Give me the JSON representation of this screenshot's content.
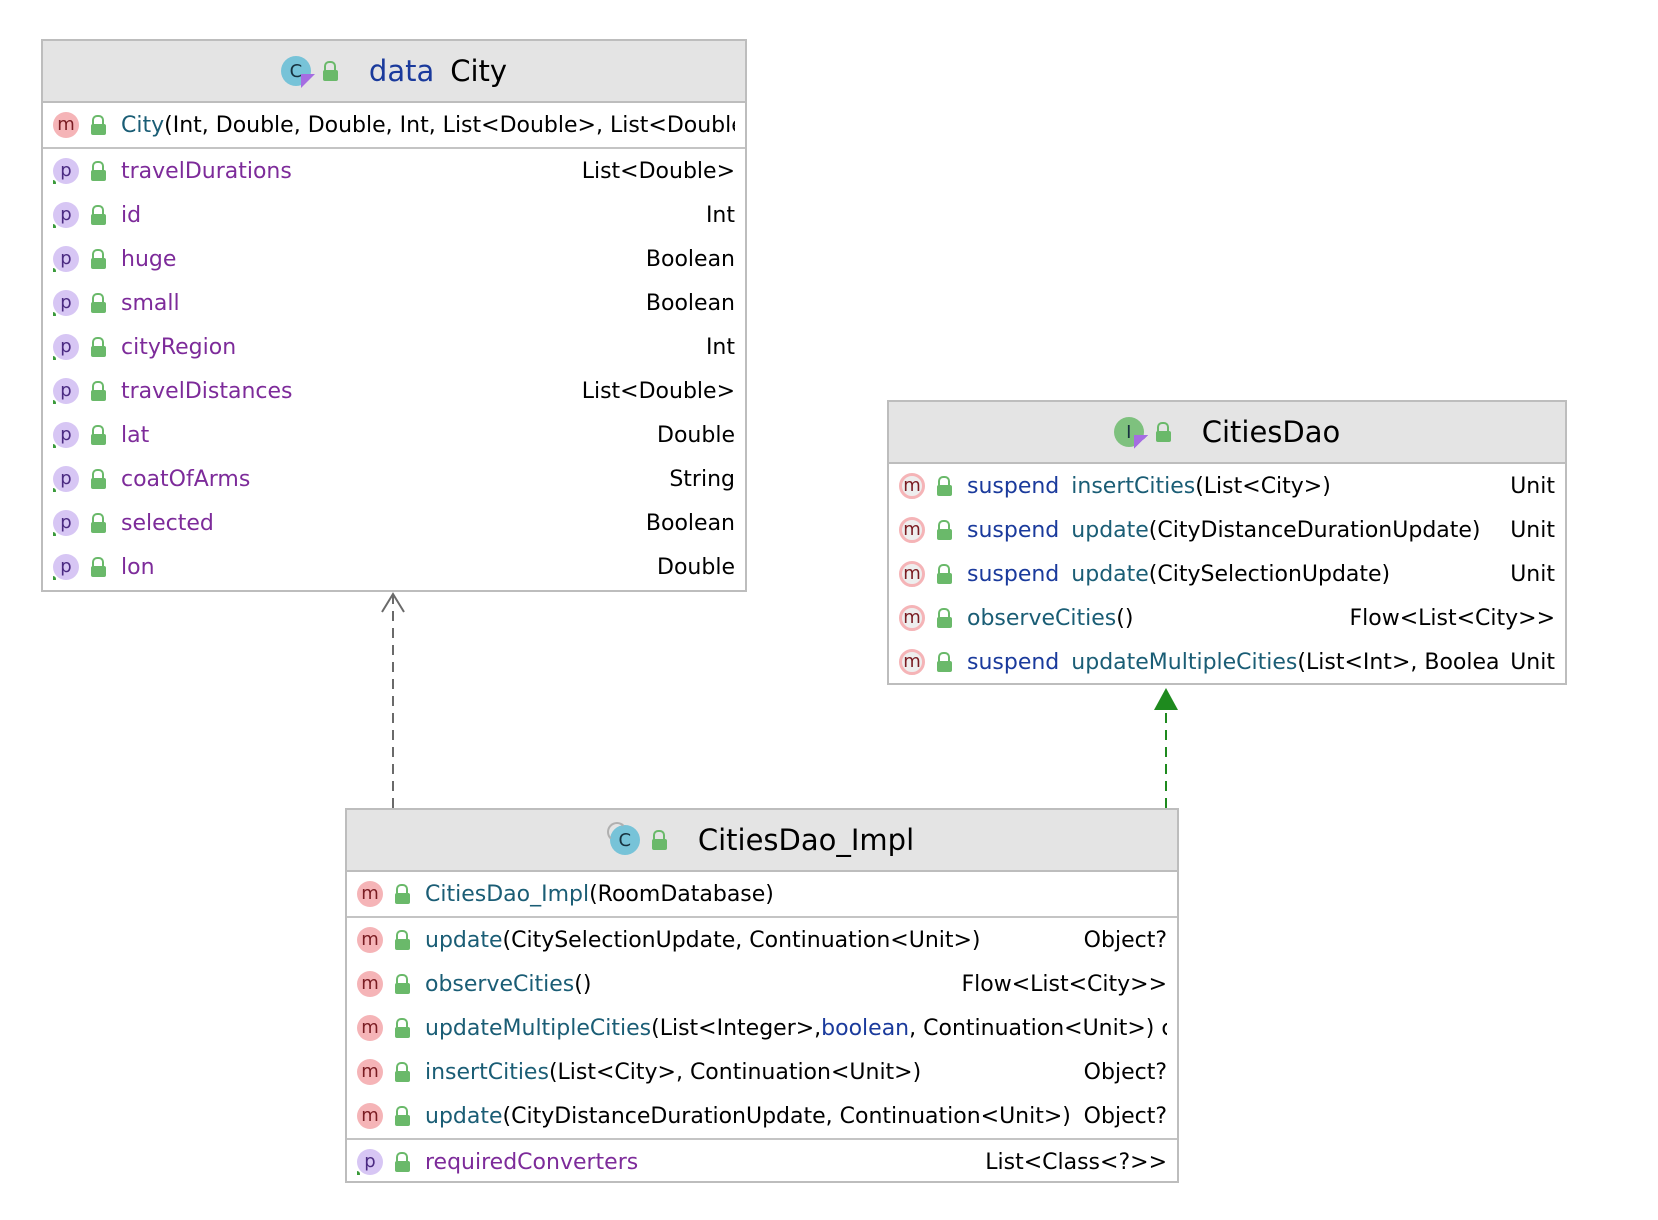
{
  "city": {
    "keyword": "data",
    "name": "City",
    "constructor": {
      "name": "City",
      "params": "(Int, Double, Double, Int, List<Double>, List<Double>, :"
    },
    "properties": [
      {
        "name": "travelDurations",
        "type": "List<Double>"
      },
      {
        "name": "id",
        "type": "Int"
      },
      {
        "name": "huge",
        "type": "Boolean"
      },
      {
        "name": "small",
        "type": "Boolean"
      },
      {
        "name": "cityRegion",
        "type": "Int"
      },
      {
        "name": "travelDistances",
        "type": "List<Double>"
      },
      {
        "name": "lat",
        "type": "Double"
      },
      {
        "name": "coatOfArms",
        "type": "String"
      },
      {
        "name": "selected",
        "type": "Boolean"
      },
      {
        "name": "lon",
        "type": "Double"
      }
    ]
  },
  "citiesDao": {
    "name": "CitiesDao",
    "icon": "interface-icon",
    "methods": [
      {
        "modifier": "suspend",
        "name": "insertCities",
        "params": "(List<City>)",
        "type": "Unit"
      },
      {
        "modifier": "suspend",
        "name": "update",
        "params": "(CityDistanceDurationUpdate)",
        "type": "Unit"
      },
      {
        "modifier": "suspend",
        "name": "update",
        "params": "(CitySelectionUpdate)",
        "type": "Unit"
      },
      {
        "modifier": "",
        "name": "observeCities",
        "params": "()",
        "type": "Flow<List<City>>"
      },
      {
        "modifier": "suspend",
        "name": "updateMultipleCities",
        "params": "(List<Int>, Boolean)",
        "type": "Unit"
      }
    ]
  },
  "impl": {
    "name": "CitiesDao_Impl",
    "constructor": {
      "name": "CitiesDao_Impl",
      "params": "(RoomDatabase)"
    },
    "methods": [
      {
        "name": "update",
        "params": "(CitySelectionUpdate, Continuation<Unit>)",
        "type": "Object?"
      },
      {
        "name": "observeCities",
        "params": "()",
        "type": "Flow<List<City>>"
      },
      {
        "name": "updateMultipleCities",
        "params_a": "(List<Integer>, ",
        "params_kw": "boolean",
        "params_b": ", Continuation<Unit>) ct?",
        "type": ""
      },
      {
        "name": "insertCities",
        "params": "(List<City>, Continuation<Unit>)",
        "type": "Object?"
      },
      {
        "name": "update",
        "params": "(CityDistanceDurationUpdate, Continuation<Unit>)",
        "type": "Object?"
      }
    ],
    "properties": [
      {
        "name": "requiredConverters",
        "type": "List<Class<?>>"
      }
    ]
  },
  "badges": {
    "method": "m",
    "property": "p",
    "class": "C",
    "interface": "I"
  },
  "colors": {
    "header_bg": "#e4e4e4",
    "border": "#bdbdbd",
    "property_name": "#7d2b9a",
    "method_name": "#1a5d75",
    "keyword": "#1a3a9c",
    "realization_arrow": "#1e8a1e",
    "dependency_arrow": "#6a6a6a"
  }
}
